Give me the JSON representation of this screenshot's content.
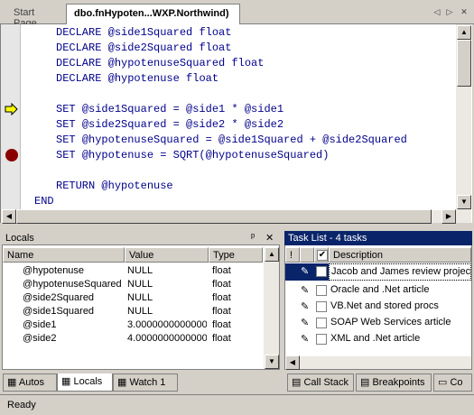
{
  "tabs": {
    "start": "Start Page",
    "active": "dbo.fnHypoten...WXP.Northwind)"
  },
  "nav": {
    "left": "◁",
    "right": "▷",
    "close": "✕"
  },
  "code": [
    {
      "kw": "DECLARE",
      "rest": "@side1Squared float"
    },
    {
      "kw": "DECLARE",
      "rest": "@side2Squared float"
    },
    {
      "kw": "DECLARE",
      "rest": "@hypotenuseSquared float"
    },
    {
      "kw": "DECLARE",
      "rest": "@hypotenuse float"
    },
    {
      "kw": "",
      "rest": ""
    },
    {
      "kw": "SET",
      "rest": "@side1Squared = @side1 * @side1"
    },
    {
      "kw": "SET",
      "rest": "@side2Squared = @side2 * @side2"
    },
    {
      "kw": "SET",
      "rest": "@hypotenuseSquared = @side1Squared + @side2Squared"
    },
    {
      "kw": "SET",
      "rest": "@hypotenuse = SQRT(@hypotenuseSquared)"
    },
    {
      "kw": "",
      "rest": ""
    },
    {
      "kw": "RETURN",
      "rest": "@hypotenuse"
    },
    {
      "kw": "END",
      "rest": ""
    }
  ],
  "locals": {
    "title": "Locals",
    "pin": "ᵖ",
    "close": "✕",
    "columns": [
      "Name",
      "Value",
      "Type"
    ],
    "rows": [
      {
        "name": "@hypotenuse",
        "value": "NULL",
        "type": "float"
      },
      {
        "name": "@hypotenuseSquared",
        "value": "NULL",
        "type": "float"
      },
      {
        "name": "@side2Squared",
        "value": "NULL",
        "type": "float"
      },
      {
        "name": "@side1Squared",
        "value": "NULL",
        "type": "float"
      },
      {
        "name": "@side1",
        "value": "3.0000000000000",
        "type": "float"
      },
      {
        "name": "@side2",
        "value": "4.0000000000000",
        "type": "float"
      }
    ]
  },
  "tasks": {
    "title": "Task List - 4 tasks",
    "col_bang": "!",
    "col_desc": "Description",
    "rows": [
      "Jacob and James review project",
      "Oracle and .Net article",
      "VB.Net and stored procs",
      "SOAP Web Services article",
      "XML and .Net article"
    ]
  },
  "bottom_tabs": {
    "autos": "Autos",
    "locals": "Locals",
    "watch": "Watch 1",
    "callstack": "Call Stack",
    "breakpoints": "Breakpoints",
    "cmd": "Co"
  },
  "status": "Ready"
}
